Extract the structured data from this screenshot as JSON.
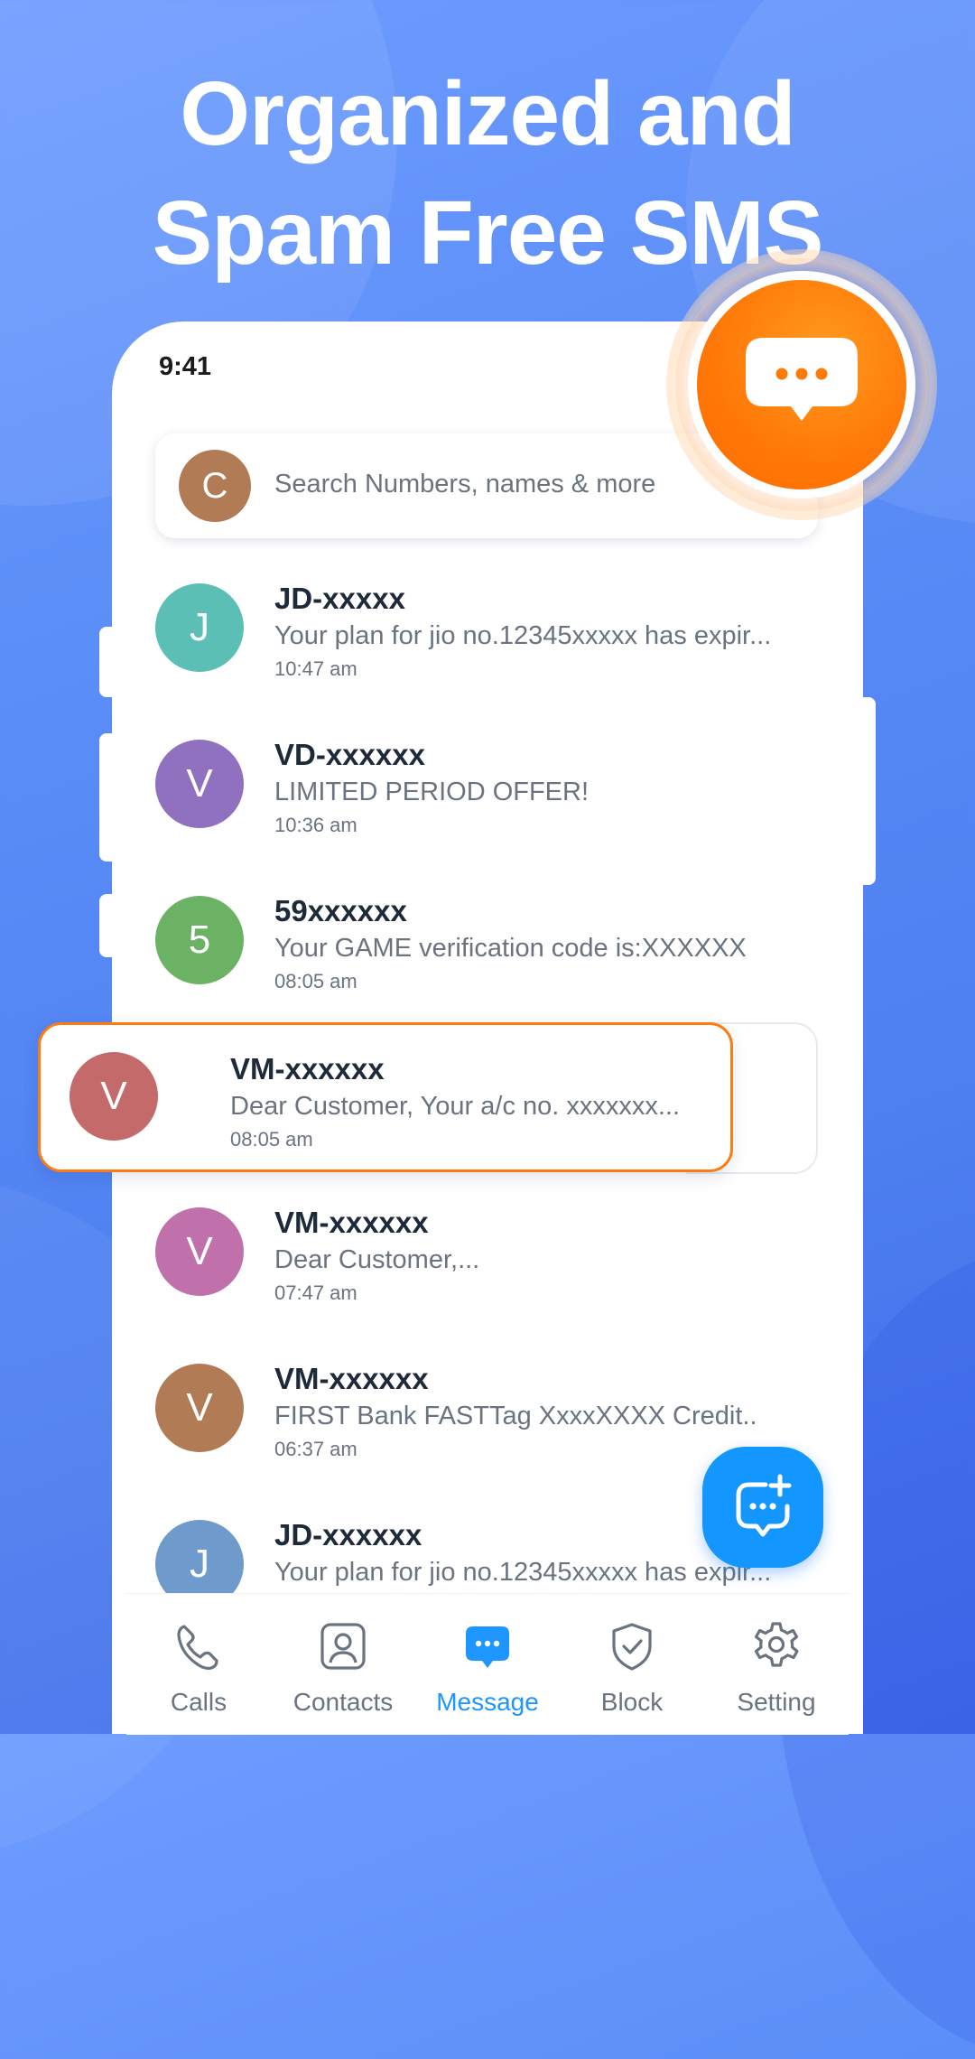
{
  "headline": {
    "line1": "Organized and",
    "line2": "Spam Free SMS"
  },
  "status_bar": {
    "time": "9:41"
  },
  "search": {
    "avatar_letter": "C",
    "placeholder": "Search Numbers, names & more"
  },
  "messages": [
    {
      "letter": "J",
      "color": "#5cbfb6",
      "name": "JD-xxxxx",
      "preview": "Your plan for jio no.12345xxxxx has expir...",
      "time": "10:47 am"
    },
    {
      "letter": "V",
      "color": "#9071c0",
      "name": "VD-xxxxxx",
      "preview": "LIMITED PERIOD OFFER!",
      "time": "10:36 am"
    },
    {
      "letter": "5",
      "color": "#6cb264",
      "name": "59xxxxxx",
      "preview": "Your GAME verification code is:XXXXXX",
      "time": "08:05 am"
    },
    {
      "letter": "V",
      "color": "#c56a6a",
      "name": "VM-xxxxxx",
      "preview": "Dear Customer, Your a/c no. xxxxxxx...",
      "time": "08:05 am"
    },
    {
      "letter": "V",
      "color": "#c070ab",
      "name": "VM-xxxxxx",
      "preview": "Dear Customer,...",
      "time": "07:47 am"
    },
    {
      "letter": "V",
      "color": "#b07b55",
      "name": "VM-xxxxxx",
      "preview": "FIRST Bank FASTTag XxxxXXXX Credit..",
      "time": "06:37 am"
    },
    {
      "letter": "J",
      "color": "#6e9bcb",
      "name": "JD-xxxxxx",
      "preview": "Your plan for jio no.12345xxxxx has expir...",
      "time": ""
    }
  ],
  "tabs": [
    {
      "label": "Calls",
      "icon": "phone-icon"
    },
    {
      "label": "Contacts",
      "icon": "contact-icon"
    },
    {
      "label": "Message",
      "icon": "message-icon",
      "active": true
    },
    {
      "label": "Block",
      "icon": "shield-check-icon"
    },
    {
      "label": "Setting",
      "icon": "gear-icon"
    }
  ],
  "colors": {
    "accent": "#1e96ff",
    "badge": "#ff7a08",
    "highlight_border": "#ff7a10"
  },
  "fab": {
    "icon": "new-message-icon"
  },
  "badge": {
    "icon": "chat-bubble-icon"
  }
}
